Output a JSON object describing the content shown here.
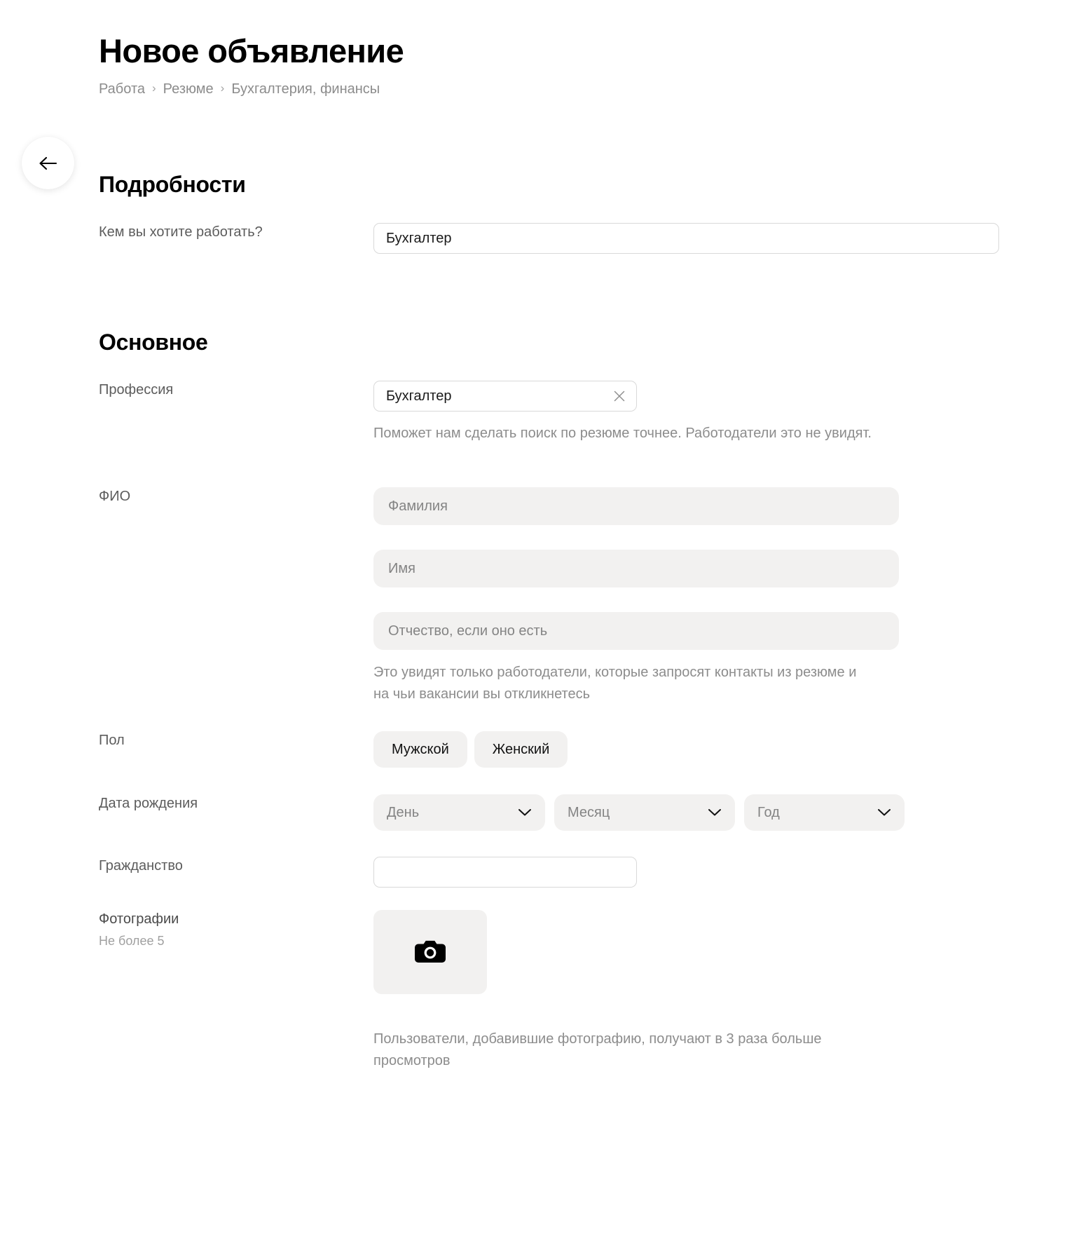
{
  "header": {
    "title": "Новое объявление",
    "breadcrumb": [
      "Работа",
      "Резюме",
      "Бухгалтерия, финансы"
    ],
    "separator": "›"
  },
  "back_button": {
    "icon": "arrow-left-icon"
  },
  "sections": {
    "details": {
      "title": "Подробности",
      "job_question": {
        "label": "Кем вы хотите работать?",
        "value": "Бухгалтер",
        "placeholder": ""
      }
    },
    "main": {
      "title": "Основное",
      "profession": {
        "label": "Профессия",
        "value": "Бухгалтер",
        "placeholder": "",
        "clear_icon": "close-icon",
        "helper": "Поможет нам сделать поиск по резюме точнее. Работодатели это не увидят."
      },
      "full_name": {
        "label": "ФИО",
        "fields": [
          {
            "placeholder": "Фамилия",
            "value": ""
          },
          {
            "placeholder": "Имя",
            "value": ""
          },
          {
            "placeholder": "Отчество, если оно есть",
            "value": ""
          }
        ],
        "helper": "Это увидят только работодатели, которые запросят контакты из резюме и на чьи вакансии вы откликнетесь"
      },
      "gender": {
        "label": "Пол",
        "options": [
          {
            "label": "Мужской",
            "selected": false
          },
          {
            "label": "Женский",
            "selected": false
          }
        ]
      },
      "birth_date": {
        "label": "Дата рождения",
        "selects": [
          {
            "placeholder": "День",
            "value": ""
          },
          {
            "placeholder": "Месяц",
            "value": ""
          },
          {
            "placeholder": "Год",
            "value": ""
          }
        ],
        "chevron_icon": "chevron-down-icon"
      },
      "citizenship": {
        "label": "Гражданство",
        "value": "",
        "placeholder": ""
      },
      "photos": {
        "label": "Фотографии",
        "sublabel": "Не более 5",
        "upload_icon": "camera-icon",
        "helper": "Пользователи, добавившие фотографию, получают в 3 раза больше просмотров"
      }
    }
  },
  "colors": {
    "field_fill": "#f2f1f0",
    "border": "#d9d9d9",
    "label": "#5c5c5c",
    "helper": "#8c8c8c",
    "text": "#000000"
  }
}
